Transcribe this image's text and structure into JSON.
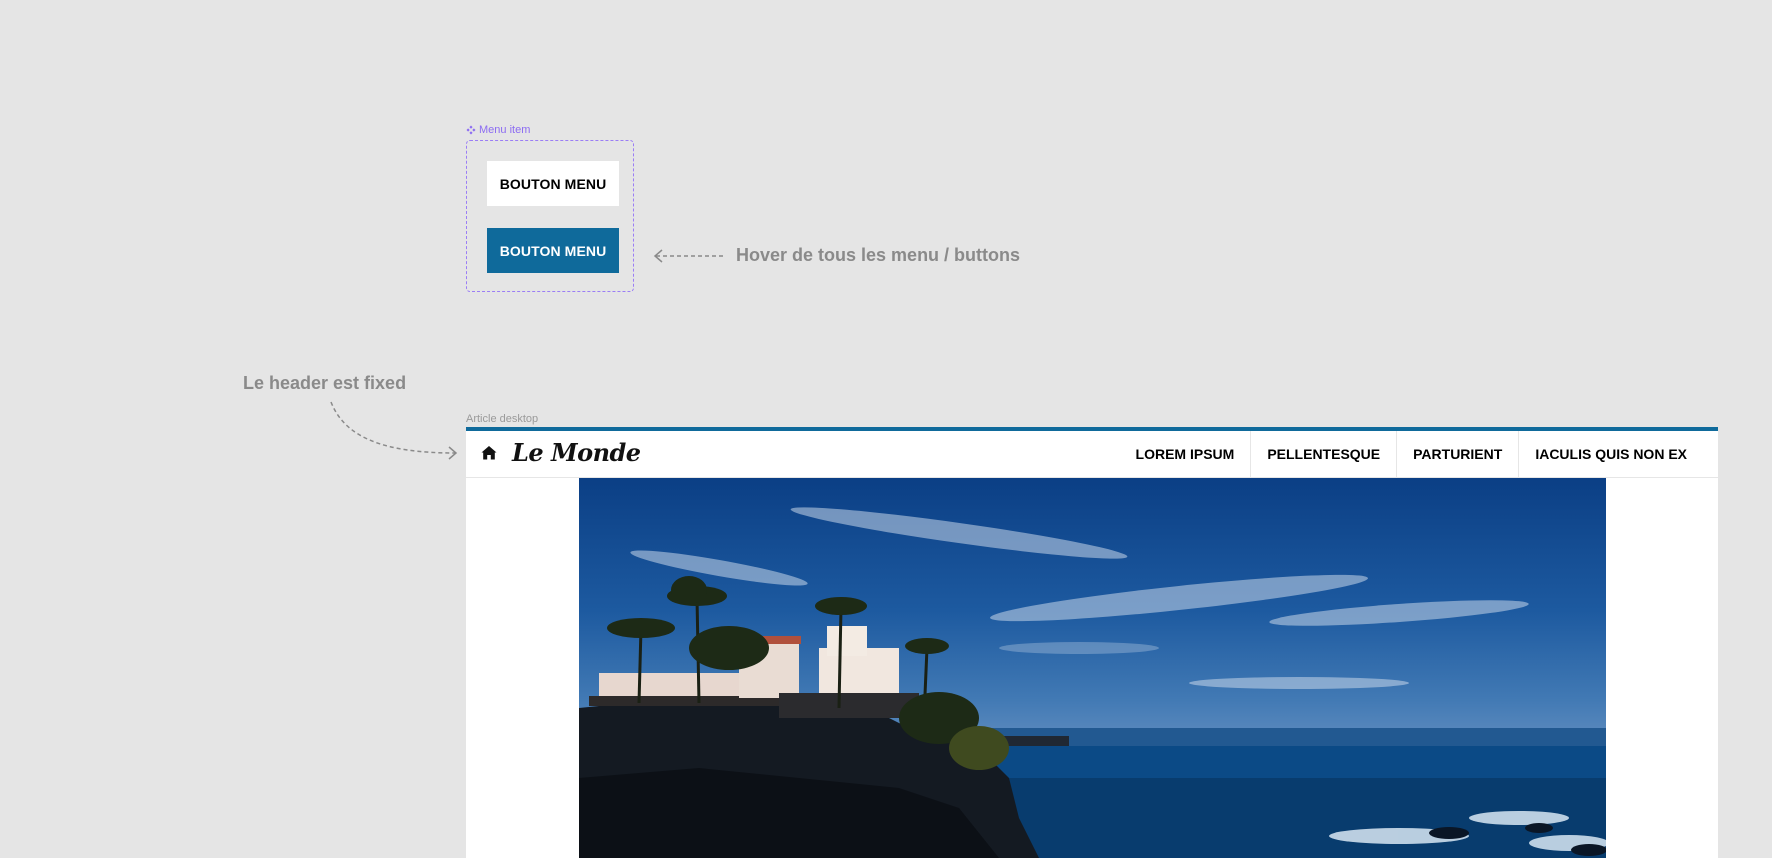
{
  "component": {
    "label": "Menu item",
    "icon": "component-diamond-icon",
    "button_default_label": "BOUTON MENU",
    "button_hover_label": "BOUTON MENU"
  },
  "notes": {
    "hover_note": "Hover de tous les menu / buttons",
    "header_note": "Le header est fixed"
  },
  "frame": {
    "label": "Article desktop"
  },
  "header": {
    "home_icon": "home-icon",
    "logo_text": "Le Monde",
    "nav": [
      {
        "label": "LOREM IPSUM"
      },
      {
        "label": "PELLENTESQUE"
      },
      {
        "label": "PARTURIENT"
      },
      {
        "label": "IACULIS QUIS NON EX"
      }
    ]
  },
  "hero": {
    "image": "coastal-villa-palm-trees-ocean-photo"
  },
  "colors": {
    "accent": "#0f6a9b",
    "component_outline": "#9b7ef5",
    "canvas": "#e5e5e5",
    "note_text": "#8a8a8a"
  }
}
